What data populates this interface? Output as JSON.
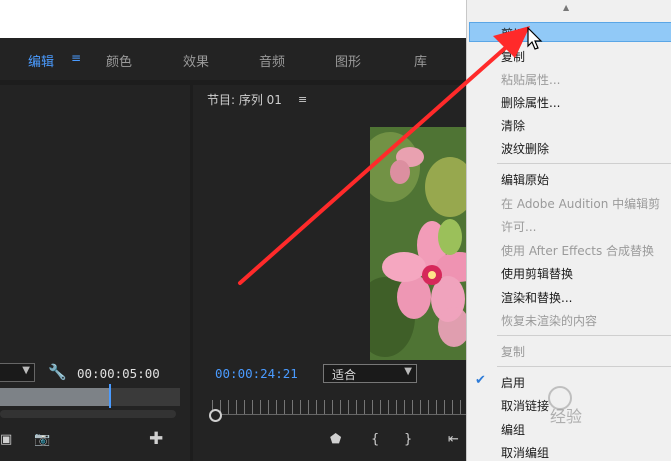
{
  "workspaces": {
    "tabs": [
      {
        "label": "编辑",
        "active": true
      },
      {
        "label": "颜色"
      },
      {
        "label": "效果"
      },
      {
        "label": "音频"
      },
      {
        "label": "图形"
      },
      {
        "label": "库"
      }
    ],
    "menu_icon": "hamburger-icon"
  },
  "source_monitor": {
    "duration": "00:00:05:00",
    "wrench_icon": "wrench-icon"
  },
  "program_monitor": {
    "title": "节目: 序列 01",
    "timecode": "00:00:24:21",
    "fit_label": "适合"
  },
  "context_menu": {
    "items": [
      {
        "label": "剪切",
        "highlighted": true
      },
      {
        "label": "复制"
      },
      {
        "label": "粘贴属性...",
        "disabled": true
      },
      {
        "label": "删除属性..."
      },
      {
        "label": "清除"
      },
      {
        "label": "波纹删除"
      },
      {
        "label": "编辑原始"
      },
      {
        "label": "在 Adobe Audition 中编辑剪",
        "disabled": true
      },
      {
        "label": "许可...",
        "disabled": true
      },
      {
        "label": "使用 After Effects 合成替换",
        "disabled": true
      },
      {
        "label": "使用剪辑替换"
      },
      {
        "label": "渲染和替换..."
      },
      {
        "label": "恢复未渲染的内容",
        "disabled": true
      },
      {
        "label": "复制",
        "disabled": true
      },
      {
        "label": "启用",
        "checked": true
      },
      {
        "label": "取消链接"
      },
      {
        "label": "编组"
      },
      {
        "label": "取消编组"
      }
    ]
  },
  "colors": {
    "accent": "#4a9bff",
    "highlight": "#91c9f7",
    "annotation_arrow": "#ff2a2a"
  }
}
